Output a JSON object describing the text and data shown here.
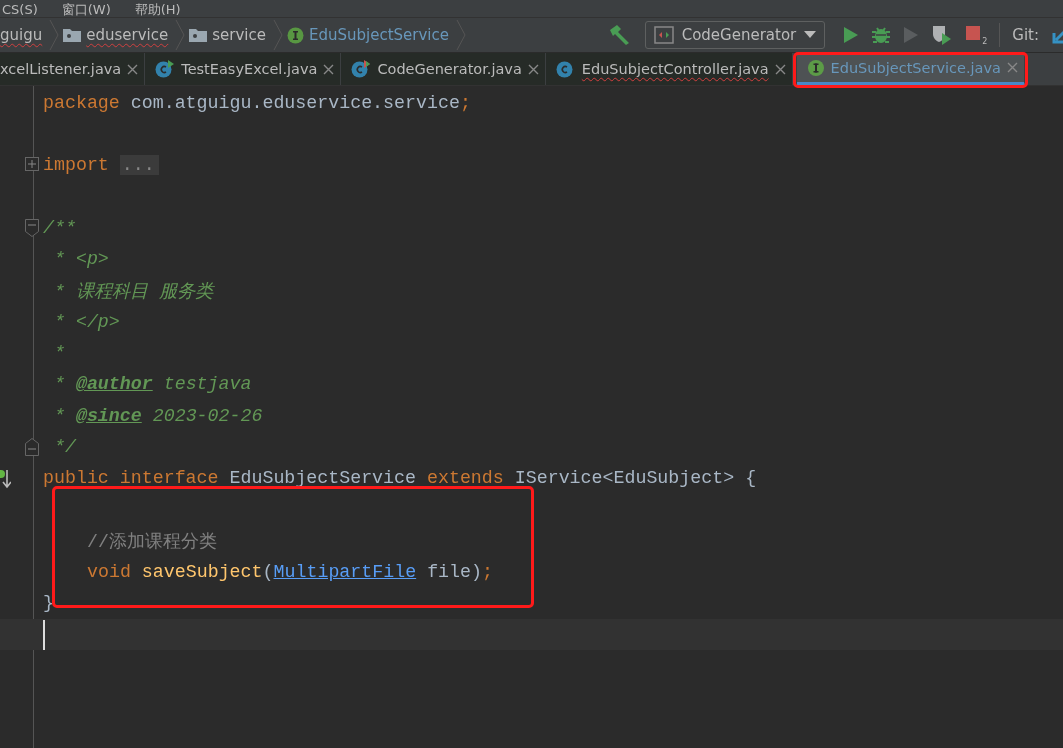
{
  "menu": [
    {
      "label": "CS(S)"
    },
    {
      "label": "窗口(W)"
    },
    {
      "label": "帮助(H)"
    }
  ],
  "breadcrumbs": [
    {
      "label": "guigu",
      "kind": "plain",
      "error": true,
      "current": false
    },
    {
      "label": "eduservice",
      "kind": "folder",
      "error": true,
      "current": false
    },
    {
      "label": "service",
      "kind": "folder",
      "error": false,
      "current": false
    },
    {
      "label": "EduSubjectService",
      "kind": "interface",
      "error": false,
      "current": true
    }
  ],
  "toolbar": {
    "run_config": "CodeGenerator",
    "stop_badge": "2",
    "vcs_label": "Git:"
  },
  "tabs": [
    {
      "label": "xcelListener.java",
      "kind": "plain",
      "error": false,
      "selected": false,
      "boxed": false
    },
    {
      "label": "TestEasyExcel.java",
      "kind": "class-run",
      "error": false,
      "selected": false,
      "boxed": false
    },
    {
      "label": "CodeGenerator.java",
      "kind": "class-mixed",
      "error": false,
      "selected": false,
      "boxed": false
    },
    {
      "label": "EduSubjectController.java",
      "kind": "class",
      "error": true,
      "selected": false,
      "boxed": false
    },
    {
      "label": "EduSubjectService.java",
      "kind": "interface",
      "error": false,
      "selected": true,
      "boxed": true
    }
  ],
  "editor": {
    "lines": [
      {
        "kind": "code",
        "tokens": [
          {
            "kind": "keyword",
            "text": "package"
          },
          {
            "kind": "plain",
            "text": " com.atguigu.eduservice.service"
          },
          {
            "kind": "keyword",
            "text": ";"
          }
        ]
      },
      {
        "kind": "blank"
      },
      {
        "kind": "fold-expand",
        "tokens": [
          {
            "kind": "keyword",
            "text": "import "
          },
          {
            "kind": "folded",
            "text": "..."
          }
        ]
      },
      {
        "kind": "blank"
      },
      {
        "kind": "fold-collapse",
        "tokens": [
          {
            "kind": "javadoc",
            "text": "/**"
          }
        ]
      },
      {
        "kind": "code",
        "tokens": [
          {
            "kind": "javadoc",
            "text": " * <p>"
          }
        ]
      },
      {
        "kind": "code",
        "tokens": [
          {
            "kind": "javadoc",
            "text": " * 课程科目 服务类"
          }
        ]
      },
      {
        "kind": "code",
        "tokens": [
          {
            "kind": "javadoc",
            "text": " * </p>"
          }
        ]
      },
      {
        "kind": "code",
        "tokens": [
          {
            "kind": "javadoc",
            "text": " *"
          }
        ]
      },
      {
        "kind": "code",
        "tokens": [
          {
            "kind": "javadoc",
            "text": " * "
          },
          {
            "kind": "doctag",
            "text": "@author"
          },
          {
            "kind": "javadoc",
            "text": " testjava"
          }
        ]
      },
      {
        "kind": "code",
        "tokens": [
          {
            "kind": "javadoc",
            "text": " * "
          },
          {
            "kind": "doctag",
            "text": "@since"
          },
          {
            "kind": "javadoc",
            "text": " 2023-02-26"
          }
        ]
      },
      {
        "kind": "fold-end",
        "tokens": [
          {
            "kind": "javadoc",
            "text": " */"
          }
        ]
      },
      {
        "kind": "implemented",
        "boxed": true,
        "tokens": [
          {
            "kind": "keyword",
            "text": "public interface"
          },
          {
            "kind": "plain",
            "text": " EduSubjectService "
          },
          {
            "kind": "keyword",
            "text": "extends"
          },
          {
            "kind": "plain",
            "text": " IService<EduSubject> {"
          }
        ],
        "children": [
          {
            "kind": "blank"
          },
          {
            "kind": "code",
            "tokens": [
              {
                "kind": "comment",
                "text": "//添加课程分类"
              }
            ]
          },
          {
            "kind": "code",
            "tokens": [
              {
                "kind": "keyword",
                "text": "void "
              },
              {
                "kind": "method",
                "text": "saveSubject"
              },
              {
                "kind": "plain",
                "text": "("
              },
              {
                "kind": "link",
                "text": "MultipartFile"
              },
              {
                "kind": "plain",
                "text": " file)"
              },
              {
                "kind": "keyword",
                "text": ";"
              }
            ]
          }
        ]
      },
      {
        "kind": "code",
        "tokens": [
          {
            "kind": "plain",
            "text": "}"
          }
        ]
      },
      {
        "kind": "cursor"
      }
    ]
  }
}
